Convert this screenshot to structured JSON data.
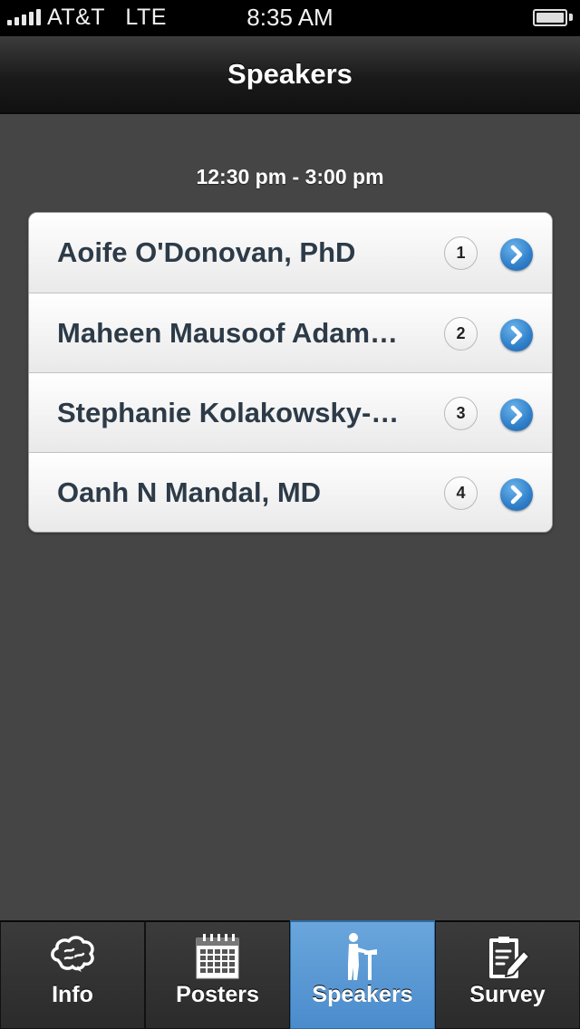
{
  "status_bar": {
    "carrier": "AT&T",
    "network": "LTE",
    "time": "8:35 AM"
  },
  "nav": {
    "title": "Speakers"
  },
  "section": {
    "time_range": "12:30 pm - 3:00 pm"
  },
  "speakers": [
    {
      "name": "Aoife O'Donovan, PhD",
      "count": "1"
    },
    {
      "name": "Maheen Mausoof Adam…",
      "count": "2"
    },
    {
      "name": "Stephanie Kolakowsky-…",
      "count": "3"
    },
    {
      "name": "Oanh N Mandal, MD",
      "count": "4"
    }
  ],
  "tabs": [
    {
      "label": "Info",
      "icon": "brain-icon"
    },
    {
      "label": "Posters",
      "icon": "calendar-icon"
    },
    {
      "label": "Speakers",
      "icon": "speaker-podium-icon",
      "active": true
    },
    {
      "label": "Survey",
      "icon": "clipboard-pen-icon"
    }
  ],
  "colors": {
    "background": "#454545",
    "text_dark": "#2d3b48",
    "accent_blue": "#4b8ccc"
  }
}
